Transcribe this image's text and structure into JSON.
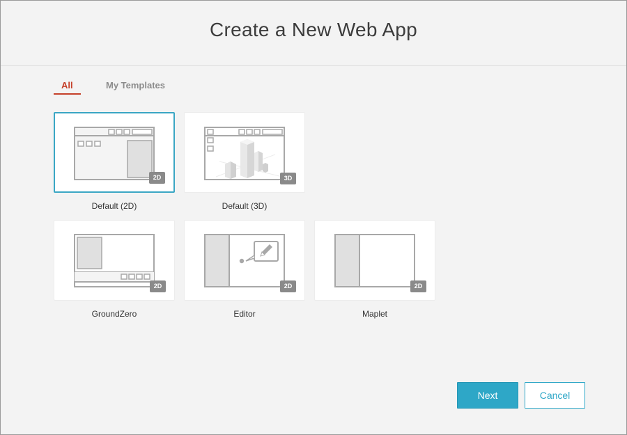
{
  "dialog": {
    "title": "Create a New Web App"
  },
  "tabs": [
    {
      "label": "All",
      "active": true
    },
    {
      "label": "My Templates",
      "active": false
    }
  ],
  "templates": [
    {
      "label": "Default (2D)",
      "badge": "2D",
      "selected": true,
      "icon": "default-2d-layout-icon"
    },
    {
      "label": "Default (3D)",
      "badge": "3D",
      "selected": false,
      "icon": "default-3d-layout-icon"
    },
    {
      "label": "GroundZero",
      "badge": "2D",
      "selected": false,
      "icon": "groundzero-layout-icon"
    },
    {
      "label": "Editor",
      "badge": "2D",
      "selected": false,
      "icon": "editor-layout-icon"
    },
    {
      "label": "Maplet",
      "badge": "2D",
      "selected": false,
      "icon": "maplet-layout-icon"
    }
  ],
  "buttons": {
    "next": "Next",
    "cancel": "Cancel"
  },
  "colors": {
    "accent": "#2ea7c7",
    "active_tab": "#c5402a",
    "badge": "#8a8a8a",
    "selected_border": "#3aa6c4"
  }
}
